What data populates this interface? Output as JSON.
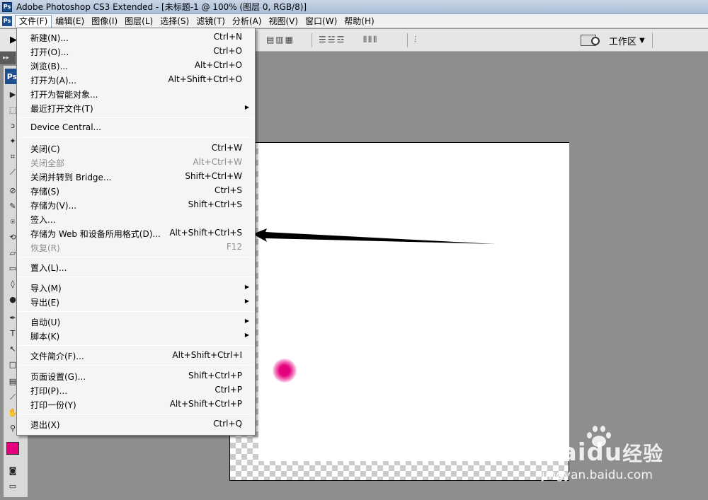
{
  "window": {
    "title": "Adobe Photoshop CS3 Extended - [未标题-1 @ 100% (图层 0, RGB/8)]",
    "ps_logo": "Ps"
  },
  "menubar": {
    "items": [
      "文件(F)",
      "编辑(E)",
      "图像(I)",
      "图层(L)",
      "选择(S)",
      "滤镜(T)",
      "分析(A)",
      "视图(V)",
      "窗口(W)",
      "帮助(H)"
    ],
    "active_index": 0
  },
  "options": {
    "workspace_label": "工作区"
  },
  "file_menu": {
    "items": [
      {
        "label": "新建(N)...",
        "shortcut": "Ctrl+N"
      },
      {
        "label": "打开(O)...",
        "shortcut": "Ctrl+O"
      },
      {
        "label": "浏览(B)...",
        "shortcut": "Alt+Ctrl+O"
      },
      {
        "label": "打开为(A)...",
        "shortcut": "Alt+Shift+Ctrl+O"
      },
      {
        "label": "打开为智能对象...",
        "shortcut": ""
      },
      {
        "label": "最近打开文件(T)",
        "shortcut": "",
        "submenu": true
      },
      {
        "label": "Device Central...",
        "shortcut": ""
      },
      {
        "label": "关闭(C)",
        "shortcut": "Ctrl+W"
      },
      {
        "label": "关闭全部",
        "shortcut": "Alt+Ctrl+W",
        "disabled": true
      },
      {
        "label": "关闭并转到 Bridge...",
        "shortcut": "Shift+Ctrl+W"
      },
      {
        "label": "存储(S)",
        "shortcut": "Ctrl+S"
      },
      {
        "label": "存储为(V)...",
        "shortcut": "Shift+Ctrl+S"
      },
      {
        "label": "签入...",
        "shortcut": ""
      },
      {
        "label": "存储为 Web 和设备所用格式(D)...",
        "shortcut": "Alt+Shift+Ctrl+S"
      },
      {
        "label": "恢复(R)",
        "shortcut": "F12",
        "disabled": true
      },
      {
        "label": "置入(L)...",
        "shortcut": ""
      },
      {
        "label": "导入(M)",
        "shortcut": "",
        "submenu": true
      },
      {
        "label": "导出(E)",
        "shortcut": "",
        "submenu": true
      },
      {
        "label": "自动(U)",
        "shortcut": "",
        "submenu": true
      },
      {
        "label": "脚本(K)",
        "shortcut": "",
        "submenu": true
      },
      {
        "label": "文件简介(F)...",
        "shortcut": "Alt+Shift+Ctrl+I"
      },
      {
        "label": "页面设置(G)...",
        "shortcut": "Shift+Ctrl+P"
      },
      {
        "label": "打印(P)...",
        "shortcut": "Ctrl+P"
      },
      {
        "label": "打印一份(Y)",
        "shortcut": "Alt+Shift+Ctrl+P"
      },
      {
        "label": "退出(X)",
        "shortcut": "Ctrl+Q"
      }
    ]
  },
  "colors": {
    "foreground": "#e4007f",
    "background": "#000000"
  },
  "watermark": {
    "brand_left": "Bai",
    "brand_right": "经验",
    "url": "jingyan.baidu.com"
  }
}
